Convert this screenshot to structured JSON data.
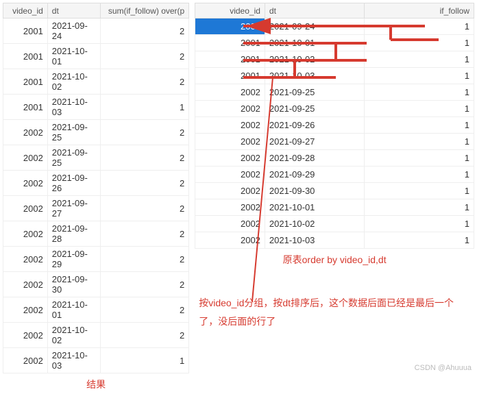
{
  "left_table": {
    "headers": [
      "video_id",
      "dt",
      "sum(if_follow) over(p"
    ],
    "rows": [
      {
        "video_id": "2001",
        "dt": "2021-09-24",
        "val": "2"
      },
      {
        "video_id": "2001",
        "dt": "2021-10-01",
        "val": "2"
      },
      {
        "video_id": "2001",
        "dt": "2021-10-02",
        "val": "2"
      },
      {
        "video_id": "2001",
        "dt": "2021-10-03",
        "val": "1"
      },
      {
        "video_id": "2002",
        "dt": "2021-09-25",
        "val": "2"
      },
      {
        "video_id": "2002",
        "dt": "2021-09-25",
        "val": "2"
      },
      {
        "video_id": "2002",
        "dt": "2021-09-26",
        "val": "2"
      },
      {
        "video_id": "2002",
        "dt": "2021-09-27",
        "val": "2"
      },
      {
        "video_id": "2002",
        "dt": "2021-09-28",
        "val": "2"
      },
      {
        "video_id": "2002",
        "dt": "2021-09-29",
        "val": "2"
      },
      {
        "video_id": "2002",
        "dt": "2021-09-30",
        "val": "2"
      },
      {
        "video_id": "2002",
        "dt": "2021-10-01",
        "val": "2"
      },
      {
        "video_id": "2002",
        "dt": "2021-10-02",
        "val": "2"
      },
      {
        "video_id": "2002",
        "dt": "2021-10-03",
        "val": "1"
      }
    ],
    "caption": "结果"
  },
  "right_table": {
    "headers": [
      "video_id",
      "dt",
      "if_follow"
    ],
    "rows": [
      {
        "video_id": "2001",
        "dt": "2021-09-24",
        "val": "1",
        "hl": true
      },
      {
        "video_id": "2001",
        "dt": "2021-10-01",
        "val": "1"
      },
      {
        "video_id": "2001",
        "dt": "2021-10-02",
        "val": "1"
      },
      {
        "video_id": "2001",
        "dt": "2021-10-03",
        "val": "1"
      },
      {
        "video_id": "2002",
        "dt": "2021-09-25",
        "val": "1"
      },
      {
        "video_id": "2002",
        "dt": "2021-09-25",
        "val": "1"
      },
      {
        "video_id": "2002",
        "dt": "2021-09-26",
        "val": "1"
      },
      {
        "video_id": "2002",
        "dt": "2021-09-27",
        "val": "1"
      },
      {
        "video_id": "2002",
        "dt": "2021-09-28",
        "val": "1"
      },
      {
        "video_id": "2002",
        "dt": "2021-09-29",
        "val": "1"
      },
      {
        "video_id": "2002",
        "dt": "2021-09-30",
        "val": "1"
      },
      {
        "video_id": "2002",
        "dt": "2021-10-01",
        "val": "1"
      },
      {
        "video_id": "2002",
        "dt": "2021-10-02",
        "val": "1"
      },
      {
        "video_id": "2002",
        "dt": "2021-10-03",
        "val": "1"
      }
    ],
    "caption": "原表order by video_id,dt"
  },
  "note_text": "按video_id分组，按dt排序后，这个数据后面已经是最后一个了，没后面的行了",
  "watermark": "CSDN @Ahuuua"
}
